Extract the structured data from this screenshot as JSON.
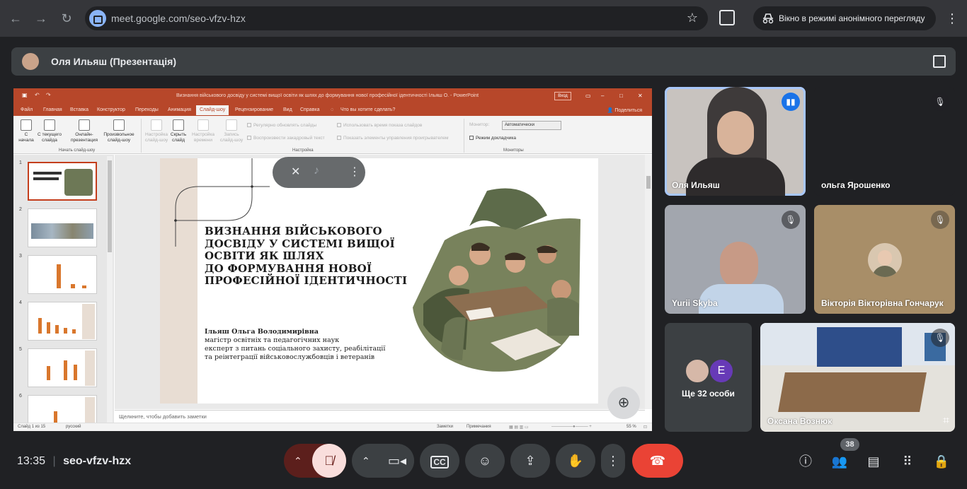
{
  "browser": {
    "url": "meet.google.com/seo-vfzv-hzx",
    "incognito_label": "Вікно в режимі анонімного перегляду"
  },
  "presenter_bar": {
    "name": "Оля Ильяш (Презентація)"
  },
  "powerpoint": {
    "window_title": "Визнання військового досвіду у системі вищої освіти як шлях до формування нової професійної ідентичності Ільяш О.  -  PowerPoint",
    "login_button": "Вход",
    "tabs": [
      "Файл",
      "Главная",
      "Вставка",
      "Конструктор",
      "Переходы",
      "Анимация",
      "Слайд-шоу",
      "Рецензирование",
      "Вид",
      "Справка",
      "Что вы хотите сделать?"
    ],
    "active_tab": "Слайд-шоу",
    "share_label": "Поделиться",
    "ribbon": {
      "from_start": "С начала",
      "from_current": "С текущего слайда",
      "online": "Онлайн-презентация",
      "custom": "Произвольное слайд-шоу",
      "group_start": "Начать слайд-шоу",
      "setup": "Настройка слайд-шоу",
      "hide": "Скрыть слайд",
      "rehearse": "Настройка времени",
      "record": "Запись слайд-шоу",
      "opt1": "Регулярно обновлять слайды",
      "opt2": "Воспроизвести закадровый текст",
      "opt3": "Использовать время показа слайдов",
      "opt4": "Показать элементы управления проигрывателем",
      "group_setup": "Настройка",
      "monitor_label": "Монитор:",
      "monitor_value": "Автоматически",
      "presenter_view": "Режим докладчика",
      "group_monitors": "Мониторы"
    },
    "thumb_numbers": [
      "1",
      "2",
      "3",
      "4",
      "5",
      "6"
    ],
    "notes_placeholder": "Щелкните, чтобы добавить заметки",
    "status": {
      "slide": "Слайд 1 из 15",
      "lang": "русский",
      "notes": "Заметки",
      "comments": "Примечания",
      "zoom": "55 %"
    },
    "slide": {
      "title_lines": [
        "ВИЗНАННЯ ВІЙСЬКОВОГО",
        "ДОСВІДУ У СИСТЕМІ ВИЩОЇ",
        "ОСВІТИ ЯК ШЛЯХ",
        "ДО ФОРМУВАННЯ НОВОЇ",
        "ПРОФЕСІЙНОЇ ІДЕНТИЧНОСТІ"
      ],
      "author": "Ільяш Ольга Володимирівна",
      "author_lines": [
        "магістр освітніх та педагогічних наук",
        "експерт з питань соціального захисту, реабілітації",
        "та реінтеграції військовослужбовців і ветеранів"
      ]
    }
  },
  "participants": [
    {
      "name": "Оля Ильяш",
      "speaking": true
    },
    {
      "name": "ольга Ярошенко",
      "muted": true
    },
    {
      "name": "Yurii Skyba",
      "muted": true
    },
    {
      "name": "Вікторія Вікторівна Гончарук",
      "muted": true
    },
    {
      "name": "Ще 32 особи",
      "avatar_letter": "E"
    },
    {
      "name": "Оксана Вознюк",
      "muted": true
    }
  ],
  "meeting": {
    "time": "13:35",
    "code": "seo-vfzv-hzx",
    "participant_count": "38"
  },
  "colors": {
    "accent": "#a8c7fa",
    "hangup": "#ea4335",
    "ppt": "#b7472a"
  }
}
